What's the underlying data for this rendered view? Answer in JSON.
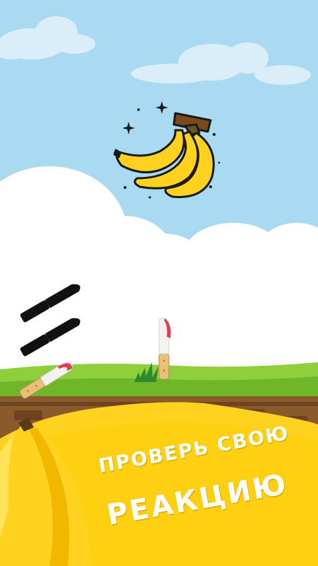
{
  "promo": {
    "line1": "ПРОВЕРЬ СВОЮ",
    "line2": "РЕАКЦИЮ"
  },
  "colors": {
    "sky": "#a9daf2",
    "cloud": "#ffffff",
    "grass": "#8fcf3c",
    "dirt": "#8b5a2b",
    "banana_yellow": "#ffd21f",
    "knife_handle": "#e9c07a",
    "knife_blade": "#f4f2ee",
    "knife_tip": "#e23c5a",
    "shadow_knife": "#111111"
  },
  "icons": [
    "banana-bunch-target",
    "knife-stuck-in-ground",
    "knife-shadow",
    "sparkle-icon",
    "grass-tuft"
  ]
}
